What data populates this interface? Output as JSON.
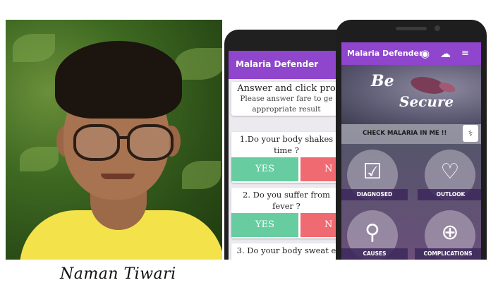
{
  "caption": "Naman Tiwari",
  "quiz_phone": {
    "app_title": "Malaria Defender",
    "intro_heading": "Answer and click pro",
    "intro_sub1": "Please answer fare to ge",
    "intro_sub2": "appropriate result",
    "questions": [
      {
        "line1": "1.Do your body shakes",
        "line2": "time ?",
        "yes": "YES",
        "no": "N"
      },
      {
        "line1": "2. Do you suffer from",
        "line2": "fever ?",
        "yes": "YES",
        "no": "N"
      },
      {
        "line1": "3. Do your body sweat e",
        "line2": "",
        "yes": "YES",
        "no": "N"
      }
    ]
  },
  "home_phone": {
    "app_title": "Malaria Defender",
    "icons": [
      "account-icon",
      "cloud-download-icon",
      "menu-icon"
    ],
    "banner_line1": "Be",
    "banner_line2": "Secure",
    "check_label": "CHECK MALARIA IN ME !!",
    "tiles": [
      {
        "label": "DIAGNOSED",
        "icon": "clipboard-icon"
      },
      {
        "label": "OUTLOOK",
        "icon": "heartbeat-icon"
      },
      {
        "label": "CAUSES",
        "icon": "magnifier-icon"
      },
      {
        "label": "COMPLICATIONS",
        "icon": "plus-circle-icon"
      }
    ]
  },
  "colors": {
    "accent": "#8f45cc",
    "yes": "#67cda1",
    "no": "#f06a72"
  }
}
